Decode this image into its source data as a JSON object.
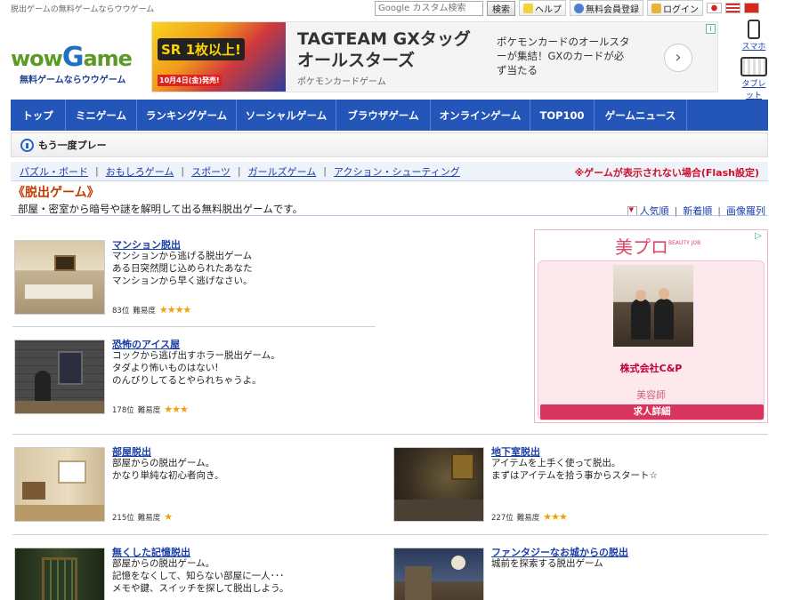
{
  "header": {
    "tagline": "脱出ゲームの無料ゲームならウウゲーム",
    "search_placeholder": "Google カスタム検索",
    "search_button": "検索",
    "help": "ヘルプ",
    "register": "無料会員登録",
    "login": "ログイン",
    "logo": {
      "w": "wow",
      "g": "G",
      "m": "ame",
      "sub": "無料ゲームならウウゲーム"
    },
    "mobile_links": {
      "phone": "スマホ",
      "tablet": "タブレット"
    }
  },
  "banner": {
    "badge": "SR 1枚以上!",
    "date": "10月4日(金)発売!",
    "title": "TAGTEAM GXタッグオールスターズ",
    "source": "ポケモンカードゲーム",
    "description": "ポケモンカードのオールスターが集結！GXのカードが必ず当たる",
    "arrow": "›"
  },
  "nav": [
    "トップ",
    "ミニゲーム",
    "ランキングゲーム",
    "ソーシャルゲーム",
    "ブラウザゲーム",
    "オンラインゲーム",
    "TOP100",
    "ゲームニュース"
  ],
  "replay": "もう一度プレー",
  "categories": [
    "パズル・ボード",
    "おもしろゲーム",
    "スポーツ",
    "ガールズゲーム",
    "アクション・シューティング"
  ],
  "flash_note": "※ゲームが表示されない場合(Flash設定)",
  "section": {
    "title": "《脱出ゲーム》",
    "description": "部屋・密室から暗号や謎を解明して出る無料脱出ゲームです。",
    "sort": [
      "人気順",
      "新着順",
      "画像羅列"
    ]
  },
  "games": [
    {
      "title": "マンション脱出",
      "desc": [
        "マンションから逃げる脱出ゲーム",
        "ある日突然閉じ込められたあなた",
        "マンションから早く逃げなさい。"
      ],
      "rank": "83位",
      "difficulty_label": "難易度",
      "stars": "★★★★"
    },
    {
      "title": "恐怖のアイス屋",
      "desc": [
        "コックから逃げ出すホラー脱出ゲーム。",
        "タダより怖いものはない!",
        "のんびりしてるとやられちゃうよ。"
      ],
      "rank": "178位",
      "difficulty_label": "難易度",
      "stars": "★★★"
    },
    {
      "title": "部屋脱出",
      "desc": [
        "部屋からの脱出ゲーム。",
        "かなり単純な初心者向き。"
      ],
      "rank": "215位",
      "difficulty_label": "難易度",
      "stars": "★"
    },
    {
      "title": "地下室脱出",
      "desc": [
        "アイテムを上手く使って脱出。",
        "まずはアイテムを拾う事からスタート☆"
      ],
      "rank": "227位",
      "difficulty_label": "難易度",
      "stars": "★★★"
    },
    {
      "title": "無くした記憶脱出",
      "desc": [
        "部屋からの脱出ゲーム。",
        "記憶をなくして、知らない部屋に一人･･･",
        "メモや鍵、スイッチを探して脱出しよう。"
      ],
      "rank": "",
      "difficulty_label": "",
      "stars": ""
    },
    {
      "title": "ファンタジーなお城からの脱出",
      "desc": [
        "城前を探索する脱出ゲーム"
      ],
      "rank": "",
      "difficulty_label": "",
      "stars": ""
    }
  ],
  "ad": {
    "logo": "美プロ",
    "logo_sub": "BEAUTY JOB",
    "company": "株式会社C&P",
    "job": "美容師",
    "button": "求人詳細"
  },
  "colors": {
    "nav": "#2455b8",
    "accent_red": "#d0102c",
    "title_orange": "#c23c00",
    "star": "#f0a10a"
  }
}
